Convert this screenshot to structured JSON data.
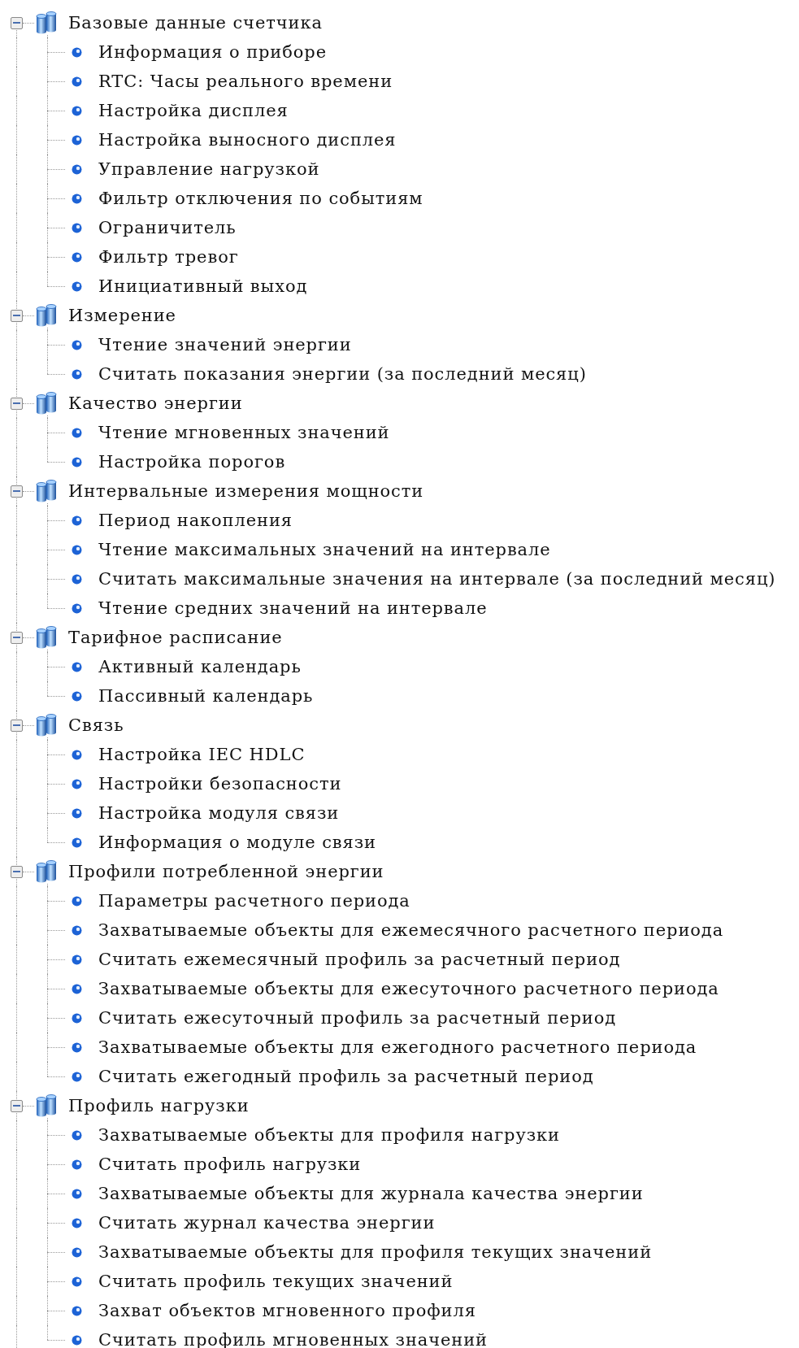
{
  "tree": [
    {
      "label": "Базовые данные счетчика",
      "expanded": true,
      "children": [
        {
          "label": "Информация о приборе"
        },
        {
          "label": "RTC: Часы реального времени"
        },
        {
          "label": "Настройка дисплея"
        },
        {
          "label": "Настройка выносного дисплея"
        },
        {
          "label": "Управление нагрузкой"
        },
        {
          "label": "Фильтр отключения по событиям"
        },
        {
          "label": "Ограничитель"
        },
        {
          "label": "Фильтр тревог"
        },
        {
          "label": "Инициативный выход"
        }
      ]
    },
    {
      "label": "Измерение",
      "expanded": true,
      "children": [
        {
          "label": "Чтение значений энергии"
        },
        {
          "label": "Считать показания энергии (за последний месяц)"
        }
      ]
    },
    {
      "label": "Качество энергии",
      "expanded": true,
      "children": [
        {
          "label": "Чтение мгновенных значений"
        },
        {
          "label": "Настройка порогов"
        }
      ]
    },
    {
      "label": "Интервальные измерения мощности",
      "expanded": true,
      "children": [
        {
          "label": "Период накопления"
        },
        {
          "label": "Чтение максимальных значений на интервале"
        },
        {
          "label": "Считать максимальные значения на интервале (за последний месяц)"
        },
        {
          "label": "Чтение средних значений на интервале"
        }
      ]
    },
    {
      "label": "Тарифное расписание",
      "expanded": true,
      "children": [
        {
          "label": "Активный календарь"
        },
        {
          "label": "Пассивный календарь"
        }
      ]
    },
    {
      "label": "Связь",
      "expanded": true,
      "children": [
        {
          "label": "Настройка IEC HDLC"
        },
        {
          "label": "Настройки безопасности"
        },
        {
          "label": "Настройка модуля связи"
        },
        {
          "label": "Информация о модуле связи"
        }
      ]
    },
    {
      "label": "Профили потребленной энергии",
      "expanded": true,
      "children": [
        {
          "label": "Параметры расчетного периода"
        },
        {
          "label": "Захватываемые объекты для ежемесячного расчетного периода"
        },
        {
          "label": "Считать ежемесячный профиль за расчетный период"
        },
        {
          "label": "Захватываемые объекты для ежесуточного расчетного периода"
        },
        {
          "label": "Считать ежесуточный профиль за расчетный период"
        },
        {
          "label": "Захватываемые объекты для ежегодного расчетного периода"
        },
        {
          "label": "Считать ежегодный профиль за расчетный период"
        }
      ]
    },
    {
      "label": "Профиль нагрузки",
      "expanded": true,
      "children": [
        {
          "label": "Захватываемые объекты для профиля нагрузки"
        },
        {
          "label": "Считать профиль нагрузки"
        },
        {
          "label": "Захватываемые объекты для журнала качества энергии"
        },
        {
          "label": "Считать журнал качества энергии"
        },
        {
          "label": "Захватываемые объекты для профиля текущих значений"
        },
        {
          "label": "Считать профиль текущих значений"
        },
        {
          "label": "Захват объектов мгновенного профиля"
        },
        {
          "label": "Считать профиль мгновенных значений"
        }
      ]
    }
  ]
}
